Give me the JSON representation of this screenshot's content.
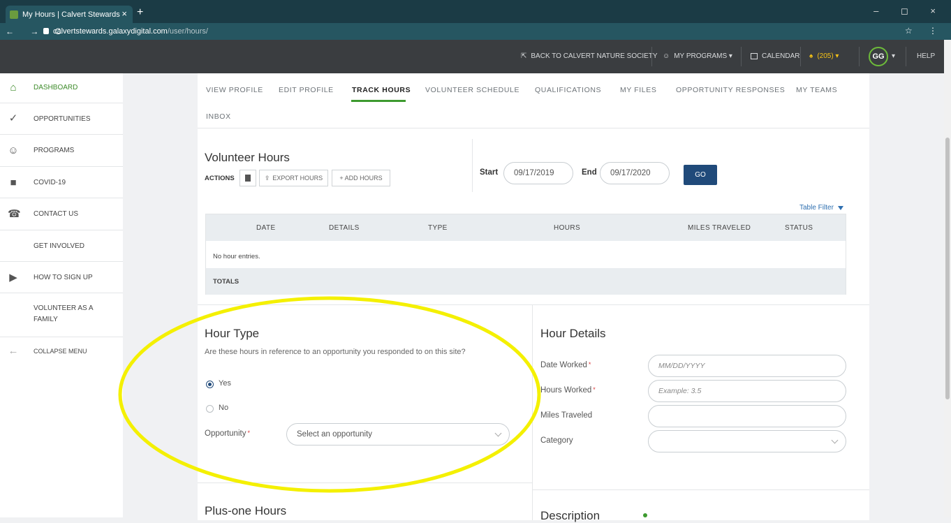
{
  "browser": {
    "tab_title": "My Hours | Calvert Stewards",
    "tab_close": "×",
    "new_tab": "+",
    "url_host": "calvertstewards.galaxydigital.com",
    "url_path": "/user/hours/",
    "nav_glyphs": "← → C",
    "window_controls": "– ◻ ×",
    "right_glyphs": "☆ ⋮"
  },
  "topbar": {
    "back_link": "BACK TO CALVERT NATURE SOCIETY",
    "my_programs": "MY PROGRAMS ▾",
    "calendar": "CALENDAR",
    "notifications": "(205) ▾",
    "avatar_initials": "GG",
    "avatar_caret": "▾",
    "help": "HELP"
  },
  "sidebar": {
    "items": [
      {
        "label": "DASHBOARD",
        "icon": "home-icon",
        "glyph": "⌂"
      },
      {
        "label": "OPPORTUNITIES",
        "icon": "check-circle-icon",
        "glyph": "✓"
      },
      {
        "label": "PROGRAMS",
        "icon": "people-icon",
        "glyph": "☺"
      },
      {
        "label": "COVID-19",
        "icon": "circle-square-icon",
        "glyph": "■"
      },
      {
        "label": "CONTACT US",
        "icon": "phone-icon",
        "glyph": "☎"
      },
      {
        "label": "GET INVOLVED"
      },
      {
        "label": "HOW TO SIGN UP",
        "icon": "video-people-icon",
        "glyph": "▶"
      },
      {
        "label": "VOLUNTEER AS A FAMILY"
      },
      {
        "label": "COLLAPSE MENU",
        "icon": "collapse-arrow-icon",
        "glyph": "←"
      }
    ]
  },
  "profile_tabs": {
    "view_profile": "VIEW PROFILE",
    "edit_profile": "EDIT PROFILE",
    "track_hours": "TRACK HOURS",
    "volunteer_schedule": "VOLUNTEER SCHEDULE",
    "qualifications": "QUALIFICATIONS",
    "my_files": "MY FILES",
    "opportunity_responses": "OPPORTUNITY RESPONSES",
    "my_teams": "MY TEAMS",
    "inbox": "INBOX"
  },
  "hours": {
    "title": "Volunteer Hours",
    "actions_label": "ACTIONS",
    "export_label": "EXPORT HOURS",
    "add_label": "+ ADD HOURS",
    "start_label": "Start",
    "start_value": "09/17/2019",
    "end_label": "End",
    "end_value": "09/17/2020",
    "go_label": "GO",
    "table_filter": "Table Filter"
  },
  "table": {
    "columns": [
      "DATE",
      "DETAILS",
      "TYPE",
      "HOURS",
      "MILES TRAVELED",
      "STATUS"
    ],
    "empty_text": "No hour entries.",
    "totals_label": "TOTALS"
  },
  "hour_type": {
    "title": "Hour Type",
    "question": "Are these hours in reference to an opportunity you responded to on this site?",
    "yes_label": "Yes",
    "no_label": "No",
    "selected": "Yes",
    "opportunity_label": "Opportunity",
    "required_mark": "*",
    "opportunity_placeholder": "Select an opportunity"
  },
  "hour_details": {
    "title": "Hour Details",
    "date_label": "Date Worked",
    "date_placeholder": "MM/DD/YYYY",
    "hours_label": "Hours Worked",
    "hours_placeholder": "Example: 3.5",
    "miles_label": "Miles Traveled",
    "category_label": "Category"
  },
  "plus_one": {
    "title": "Plus-one Hours"
  },
  "description": {
    "title": "Description"
  },
  "colors": {
    "accent_green": "#3d9a2f",
    "primary_blue": "#204a7a",
    "highlight_yellow": "#f4f000"
  }
}
